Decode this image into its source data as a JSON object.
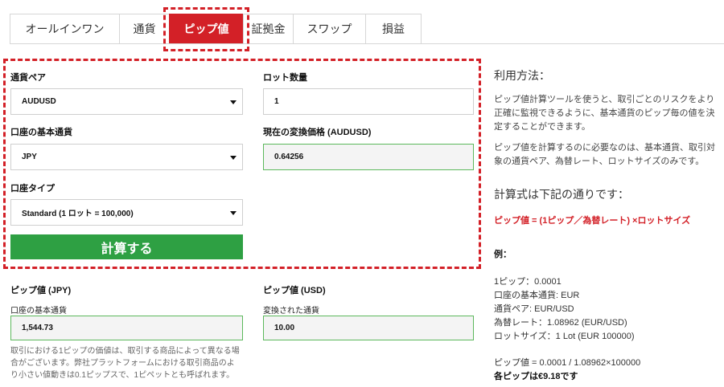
{
  "tabs": [
    {
      "label": "オールインワン",
      "active": false
    },
    {
      "label": "通貨",
      "active": false
    },
    {
      "label": "ピップ値",
      "active": true
    },
    {
      "label": "証拠金",
      "active": false
    },
    {
      "label": "スワップ",
      "active": false
    },
    {
      "label": "損益",
      "active": false
    }
  ],
  "form": {
    "currency_pair_label": "通貨ペア",
    "currency_pair_value": "AUDUSD",
    "lot_qty_label": "ロット数量",
    "lot_qty_value": "1",
    "base_currency_label": "口座の基本通貨",
    "base_currency_value": "JPY",
    "conversion_price_label": "現在の変換価格 (AUDUSD)",
    "conversion_price_value": "0.64256",
    "account_type_label": "口座タイプ",
    "account_type_value": "Standard (1 ロット = 100,000)",
    "calculate_label": "計算する"
  },
  "results": {
    "jpy_title": "ピップ値 (JPY)",
    "jpy_sub_label": "口座の基本通貨",
    "jpy_value": "1,544.73",
    "usd_title": "ピップ値 (USD)",
    "usd_sub_label": "変換された通貨",
    "usd_value": "10.00",
    "note_lines": [
      "取引における1ピップの価値は、取引する商品によって異なる場",
      "合がございます。弊社プラットフォームにおける取引商品のよ",
      "り小さい値動きは0.1ピップスで、1ピペットとも呼ばれます。"
    ]
  },
  "side": {
    "usage_heading": "利用方法：",
    "para1_lines": [
      "ピップ値計算ツールを使うと、取引ごとのリスクをより",
      "正確に監視できるように、基本通貨のピップ毎の値を決",
      "定することができます。"
    ],
    "para2_lines": [
      "ピップ値を計算するのに必要なのは、基本通貨、取引対",
      "象の通貨ペア、為替レート、ロットサイズのみです。"
    ],
    "formula_heading": "計算式は下記の通りです：",
    "formula": "ピップ値 = (1ピップ／為替レート) ×ロットサイズ",
    "example_heading": "例：",
    "example_lines": [
      "1ピップ：0.0001",
      "口座の基本通貨: EUR",
      "通貨ペア: EUR/USD",
      "為替レート：1.08962 (EUR/USD)",
      "ロットサイズ：1 Lot (EUR 100000)"
    ],
    "calc_line": "ピップ値 = 0.0001 / 1.08962×100000",
    "result_line": "各ピップは€9.18です"
  },
  "colors": {
    "accent": "#d32027",
    "button_green": "#2ea043",
    "field_green_border": "#5cb85c"
  }
}
